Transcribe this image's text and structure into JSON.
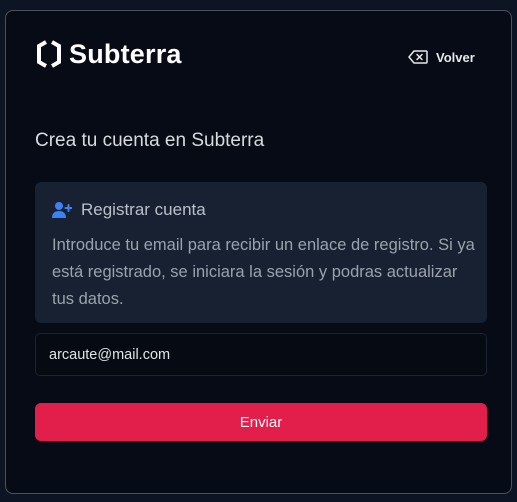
{
  "brand": {
    "name": "Subterra",
    "logo_icon": "hexagon-logo-icon"
  },
  "header": {
    "back_label": "Volver",
    "back_icon": "backspace-icon"
  },
  "heading": "Crea tu cuenta en Subterra",
  "info": {
    "icon": "user-plus-icon",
    "title": "Registrar cuenta",
    "body": "Introduce tu email para recibir un enlace de registro. Si ya está registrado, se iniciara la sesión y podras actualizar tus datos."
  },
  "form": {
    "email_value": "arcaute@mail.com",
    "submit_label": "Enviar"
  },
  "colors": {
    "accent": "#e21e4a",
    "icon_blue": "#3b82f6",
    "card_bg": "#060b15",
    "info_bg": "#172131"
  }
}
